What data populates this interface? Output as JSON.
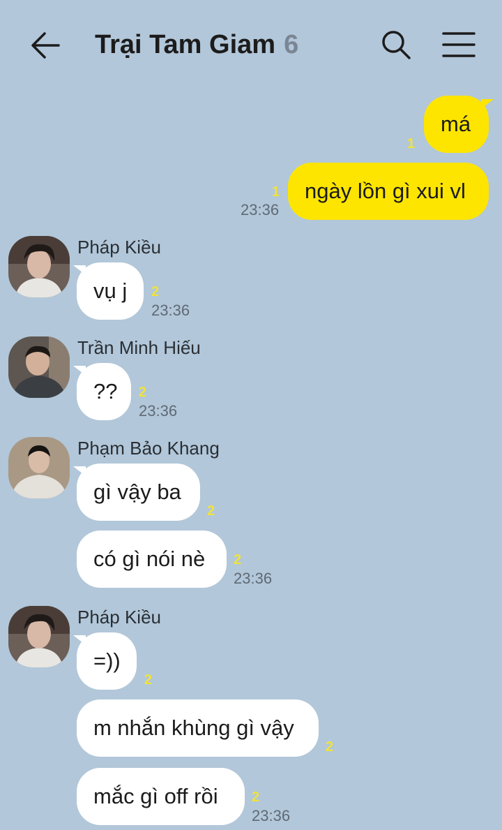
{
  "header": {
    "title": "Trại Tam Giam",
    "member_count": "6",
    "back_icon": "arrow-left-icon",
    "search_icon": "search-icon",
    "menu_icon": "hamburger-menu-icon"
  },
  "colors": {
    "background": "#b2c7d9",
    "my_bubble": "#fee500",
    "their_bubble": "#ffffff",
    "unread": "#f0e23c"
  },
  "messages": {
    "m0": {
      "text": "má",
      "unread": "1"
    },
    "m1": {
      "text": "ngày lồn gì xui vl",
      "unread": "1",
      "time": "23:36"
    },
    "g0": {
      "sender": "Pháp Kiều",
      "text": "vụ j",
      "unread": "2",
      "time": "23:36"
    },
    "g1": {
      "sender": "Trần Minh Hiếu",
      "text": "??",
      "unread": "2",
      "time": "23:36"
    },
    "g2": {
      "sender": "Phạm Bảo Khang",
      "text": "gì vậy ba",
      "unread": "2"
    },
    "g3": {
      "text": "có gì nói nè",
      "unread": "2",
      "time": "23:36"
    },
    "g4": {
      "sender": "Pháp Kiều",
      "text": "=))",
      "unread": "2"
    },
    "g5": {
      "text": "m nhắn khùng gì vậy",
      "unread": "2"
    },
    "g6": {
      "text": "mắc gì off rồi",
      "unread": "2",
      "time": "23:36"
    }
  }
}
